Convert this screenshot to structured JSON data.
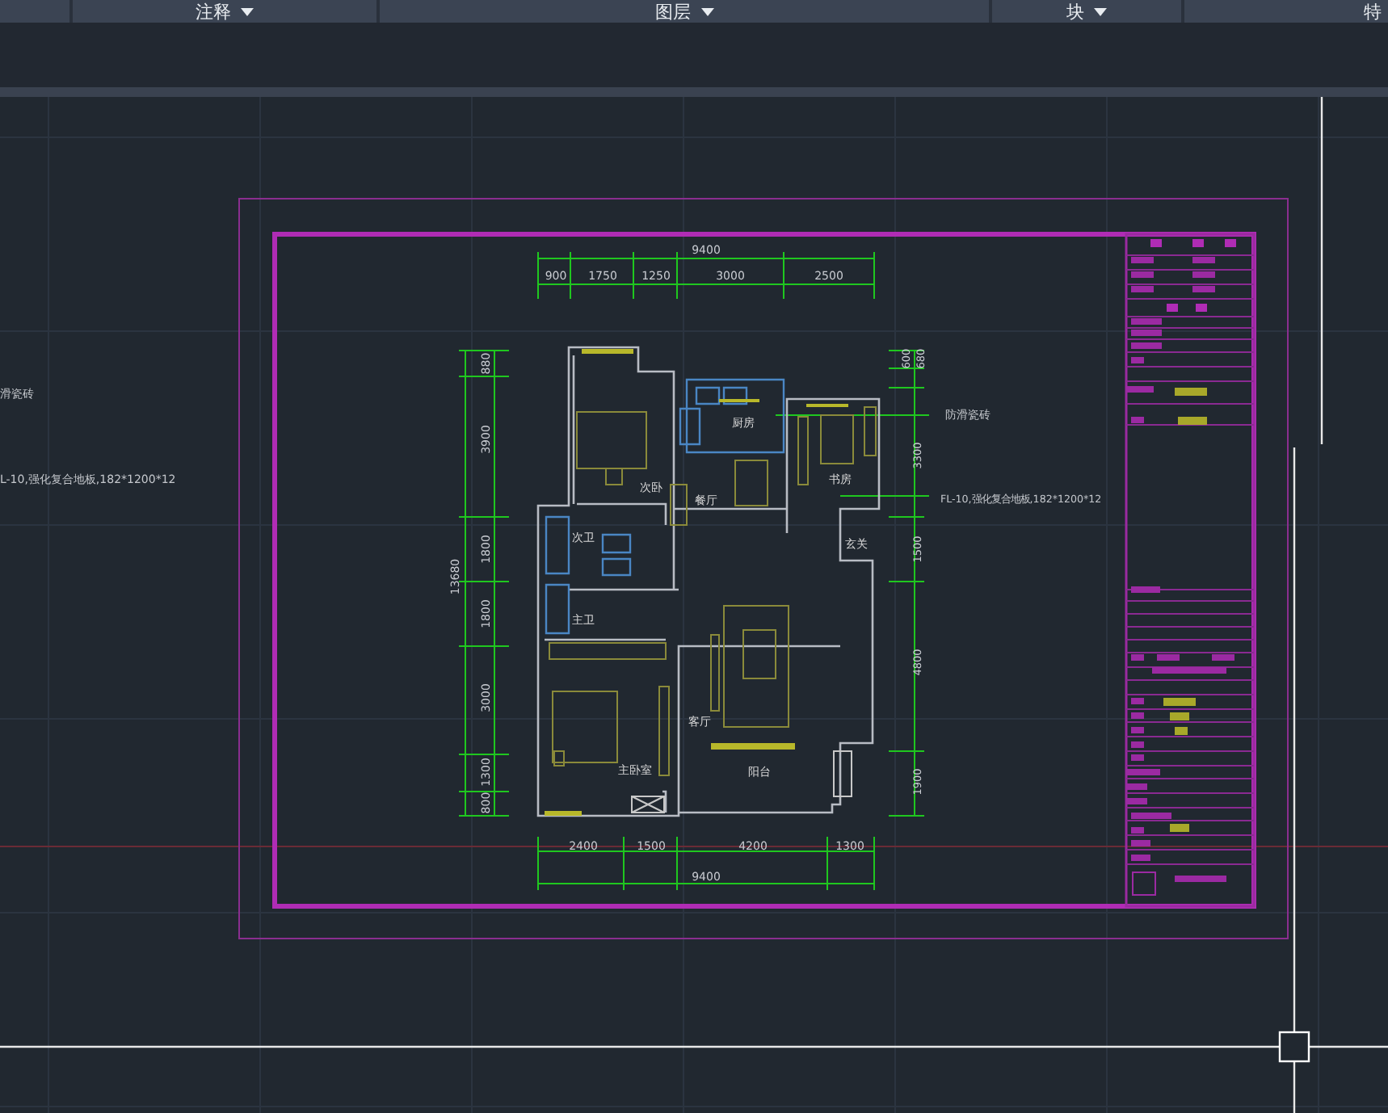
{
  "ribbon": {
    "panels": [
      {
        "label": "注释",
        "dropdown": true
      },
      {
        "label": "图层",
        "dropdown": true
      },
      {
        "label": "块",
        "dropdown": true
      },
      {
        "label": "特",
        "dropdown": false
      }
    ]
  },
  "drawing": {
    "top_dimensions": [
      "9400",
      "900",
      "1750",
      "1250",
      "3000",
      "2500"
    ],
    "left_dimensions": [
      "13680",
      "880",
      "3900",
      "1800",
      "1800",
      "3000",
      "1300",
      "800"
    ],
    "right_dimensions": [
      "600",
      "680",
      "3300",
      "1500",
      "4800",
      "1900"
    ],
    "bottom_dimensions": [
      "2400",
      "1500",
      "4200",
      "1300",
      "9400"
    ],
    "room_labels": [
      "厨房",
      "次卧",
      "书房",
      "餐厅",
      "次卫",
      "玄关",
      "主卫",
      "客厅",
      "主卧室",
      "阳台"
    ],
    "notes": [
      "滑瓷砖",
      "L-10,强化复合地板,182*1200*12",
      "防滑瓷砖",
      "FL-10,强化复合地板,182*1200*12"
    ]
  }
}
